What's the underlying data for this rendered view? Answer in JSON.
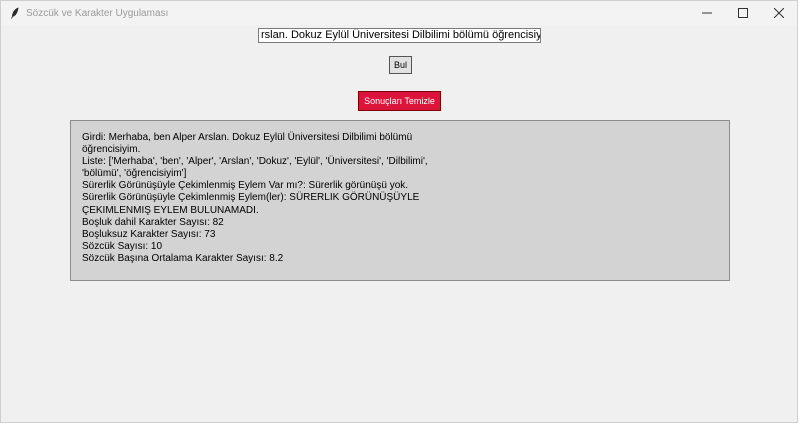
{
  "window": {
    "title": "Sözcük ve Karakter Uygulaması",
    "controls": {
      "minimize": "—",
      "maximize": "☐",
      "close": "✕"
    }
  },
  "search": {
    "value": "rslan. Dokuz Eylül Üniversitesi Dilbilimi bölümü öğrencisiyim."
  },
  "buttons": {
    "find_label": "Bul",
    "clear_label": "Sonuçları Temizle",
    "clear_color": "#dc143c"
  },
  "results": {
    "lines": [
      "Girdi: Merhaba, ben Alper Arslan. Dokuz Eylül Üniversitesi Dilbilimi bölümü",
      "öğrencisiyim.",
      "Liste: ['Merhaba', 'ben', 'Alper', 'Arslan', 'Dokuz', 'Eylül', 'Üniversitesi', 'Dilbilimi',",
      "'bölümü', 'öğrencisiyim']",
      "Sürerlik Görünüşüyle Çekimlenmiş Eylem Var mı?: Sürerlik görünüşü yok.",
      "Sürerlik Görünüşüyle Çekimlenmiş Eylem(ler): SÜRERLIK GÖRÜNÜŞÜYLE",
      "ÇEKIMLENMIŞ EYLEM BULUNAMADI.",
      "Boşluk dahil Karakter Sayısı: 82",
      "Boşluksuz Karakter Sayısı: 73",
      "Sözcük Sayısı: 10",
      "Sözcük Başına Ortalama Karakter Sayısı: 8.2"
    ]
  }
}
